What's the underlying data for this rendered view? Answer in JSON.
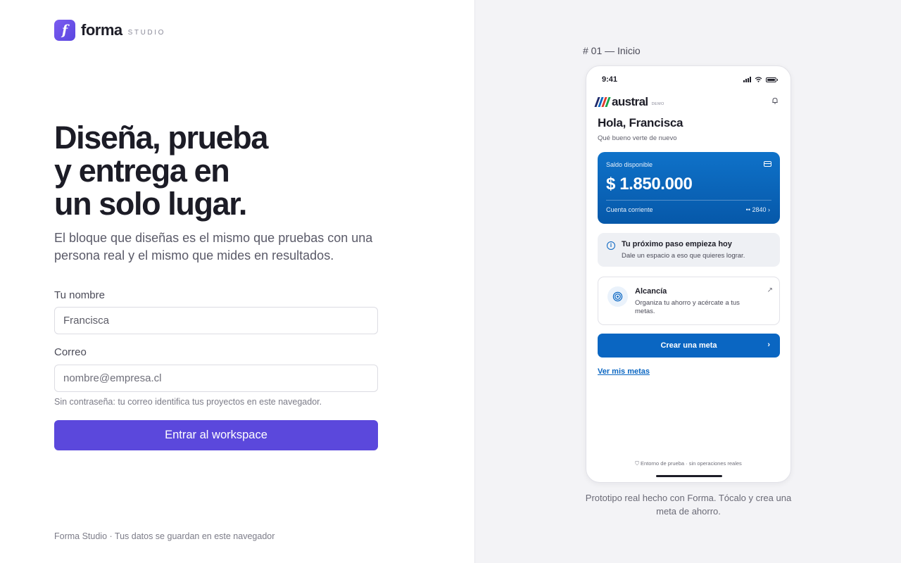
{
  "brand": {
    "logo_letter": "f",
    "name": "forma",
    "tagline": "STUDIO"
  },
  "hero": {
    "headline_lines": [
      "Diseña, prueba",
      "y entrega en",
      "un solo lugar."
    ],
    "subtitle": "El bloque que diseñas es el mismo que pruebas con una persona real y el mismo que mides en resultados."
  },
  "form": {
    "name_label": "Tu nombre",
    "name_value": "Francisca",
    "email_label": "Correo",
    "email_placeholder": "nombre@empresa.cl",
    "hint": "Sin contraseña: tu correo identifica tus proyectos en este navegador.",
    "submit_label": "Entrar al workspace",
    "accent_color": "#5b48dc"
  },
  "footer": "Forma Studio · Tus datos se guardan en este navegador",
  "preview": {
    "screen_label": "# 01 — Inicio",
    "status_time": "9:41",
    "app": {
      "brand_name": "austral",
      "brand_badge": "DEMO",
      "brand_stripe_colors": [
        "#1f2a6b",
        "#0a66c2",
        "#e0392b",
        "#19a34a"
      ],
      "greeting": "Hola, Francisca",
      "greeting_sub": "Qué bueno verte de nuevo",
      "balance": {
        "label": "Saldo disponible",
        "amount": "$ 1.850.000",
        "account_type": "Cuenta corriente",
        "account_number": "•• 2840 ›"
      },
      "tip": {
        "title": "Tu próximo paso empieza hoy",
        "subtitle": "Dale un espacio a eso que quieres lograr."
      },
      "goal_card": {
        "title": "Alcancía",
        "subtitle": "Organiza tu ahorro y acércate a tus metas."
      },
      "cta_label": "Crear una meta",
      "link_label": "Ver mis metas",
      "environment_note": "Entorno de prueba · sin operaciones reales",
      "primary_color": "#0a66c2"
    },
    "caption": "Prototipo real hecho con Forma. Tócalo y crea una meta de ahorro."
  }
}
